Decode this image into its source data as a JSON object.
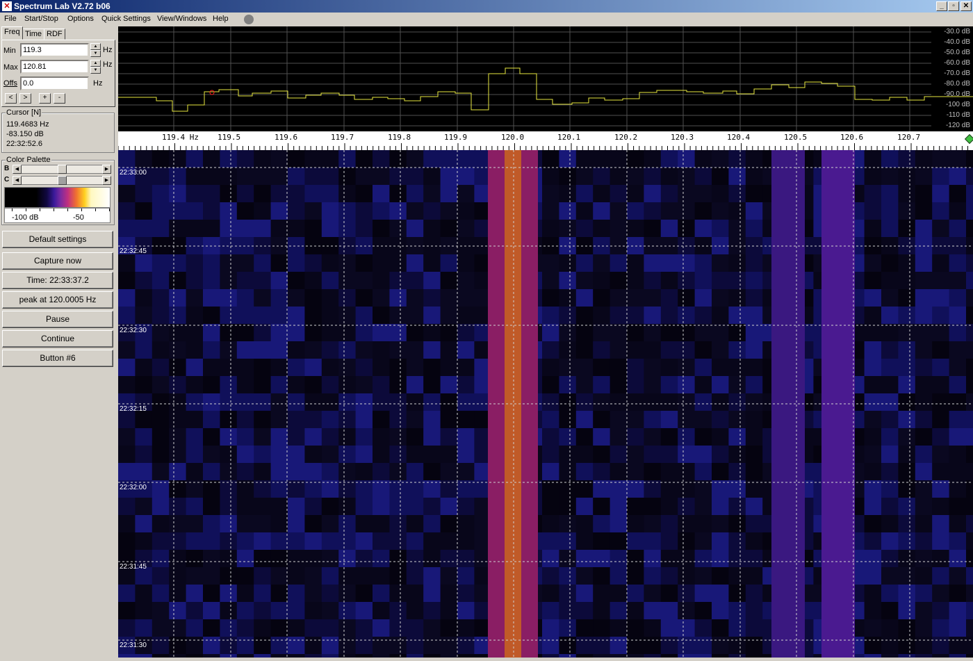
{
  "window": {
    "title": "Spectrum Lab V2.72 b06",
    "minimize": "_",
    "maximize": "▫",
    "close": "✕"
  },
  "menu": {
    "file": "File",
    "start_stop": "Start/Stop",
    "options": "Options",
    "quick_settings": "Quick Settings",
    "view_windows": "View/Windows",
    "help": "Help"
  },
  "tabs": {
    "freq": "Freq",
    "time": "Time",
    "rdf": "RDF"
  },
  "freq_panel": {
    "min_label": "Min",
    "min_value": "119.3",
    "max_label": "Max",
    "max_value": "120.81",
    "offs_label": "Offs",
    "offs_value": "0.0",
    "unit": "Hz",
    "btn_left": "<",
    "btn_right": ">",
    "btn_plus": "+",
    "btn_minus": "-"
  },
  "cursor": {
    "title": "Cursor [N]",
    "freq": "119.4683 Hz",
    "level": "-83.150 dB",
    "time": "22:32:52.6"
  },
  "palette": {
    "title": "Color Palette",
    "b_label": "B",
    "c_label": "C",
    "b_position": 0.5,
    "c_position": 0.5,
    "scale_min": "-100 dB",
    "scale_max": "-50"
  },
  "buttons": {
    "default_settings": "Default settings",
    "capture_now": "Capture now",
    "time": "Time:  22:33:37.2",
    "peak": "peak at 120.0005 Hz",
    "pause": "Pause",
    "continue": "Continue",
    "button6": "Button #6"
  },
  "spectrum": {
    "db_labels": [
      "-30.0 dB",
      "-40.0 dB",
      "-50.0 dB",
      "-60.0 dB",
      "-70.0 dB",
      "-80.0 dB",
      "-90.0 dB",
      "-100 dB",
      "-110 dB",
      "-120 dB"
    ],
    "trace_color": "#e8e840"
  },
  "freq_axis": {
    "labels": [
      "119.4 Hz",
      "119.5",
      "119.6",
      "119.7",
      "119.8",
      "119.9",
      "120.0",
      "120.1",
      "120.2",
      "120.3",
      "120.4",
      "120.5",
      "120.6",
      "120.7"
    ]
  },
  "waterfall": {
    "time_labels": [
      "22:33:00",
      "22:32:45",
      "22:32:30",
      "22:32:15",
      "22:32:00",
      "22:31:45",
      "22:31:30"
    ]
  }
}
